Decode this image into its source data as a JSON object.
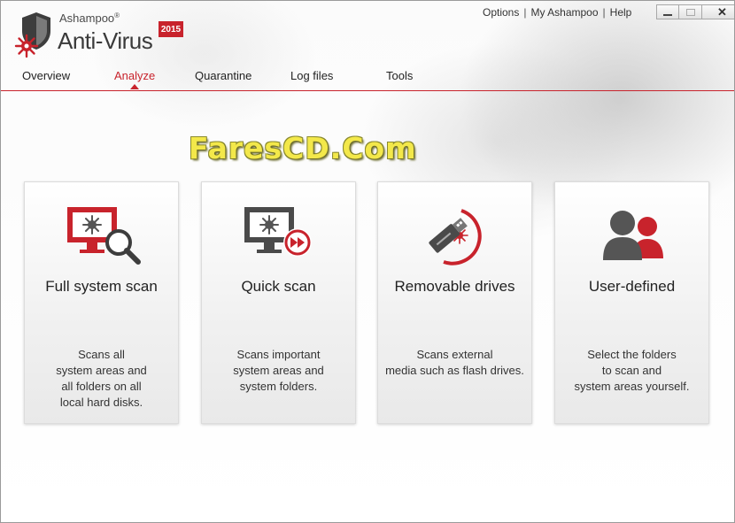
{
  "app": {
    "brand": "Ashampoo",
    "brand_mark": "®",
    "product": "Anti-Virus",
    "year": "2015"
  },
  "toplinks": [
    "Options",
    "My Ashampoo",
    "Help"
  ],
  "toplink_separator": "|",
  "window_controls": {
    "close": "✕"
  },
  "tabs": [
    {
      "label": "Overview",
      "active": false
    },
    {
      "label": "Analyze",
      "active": true
    },
    {
      "label": "Quarantine",
      "active": false
    },
    {
      "label": "Log files",
      "active": false
    },
    {
      "label": "Tools",
      "active": false
    }
  ],
  "watermark": "FaresCD.Com",
  "cards": [
    {
      "title": "Full system scan",
      "icon": "monitor-magnifier-icon",
      "desc": [
        "Scans all",
        "system areas and",
        "all folders on all",
        "local hard disks."
      ]
    },
    {
      "title": "Quick scan",
      "icon": "monitor-fast-forward-icon",
      "desc": [
        "Scans important",
        "system areas and",
        "system folders."
      ]
    },
    {
      "title": "Removable drives",
      "icon": "usb-drive-icon",
      "desc": [
        "Scans external",
        "media such as flash drives."
      ]
    },
    {
      "title": "User-defined",
      "icon": "users-icon",
      "desc": [
        "Select the folders",
        "to scan and",
        "system areas yourself."
      ]
    }
  ],
  "colors": {
    "accent": "#c8232c",
    "icon_gray": "#555555"
  }
}
